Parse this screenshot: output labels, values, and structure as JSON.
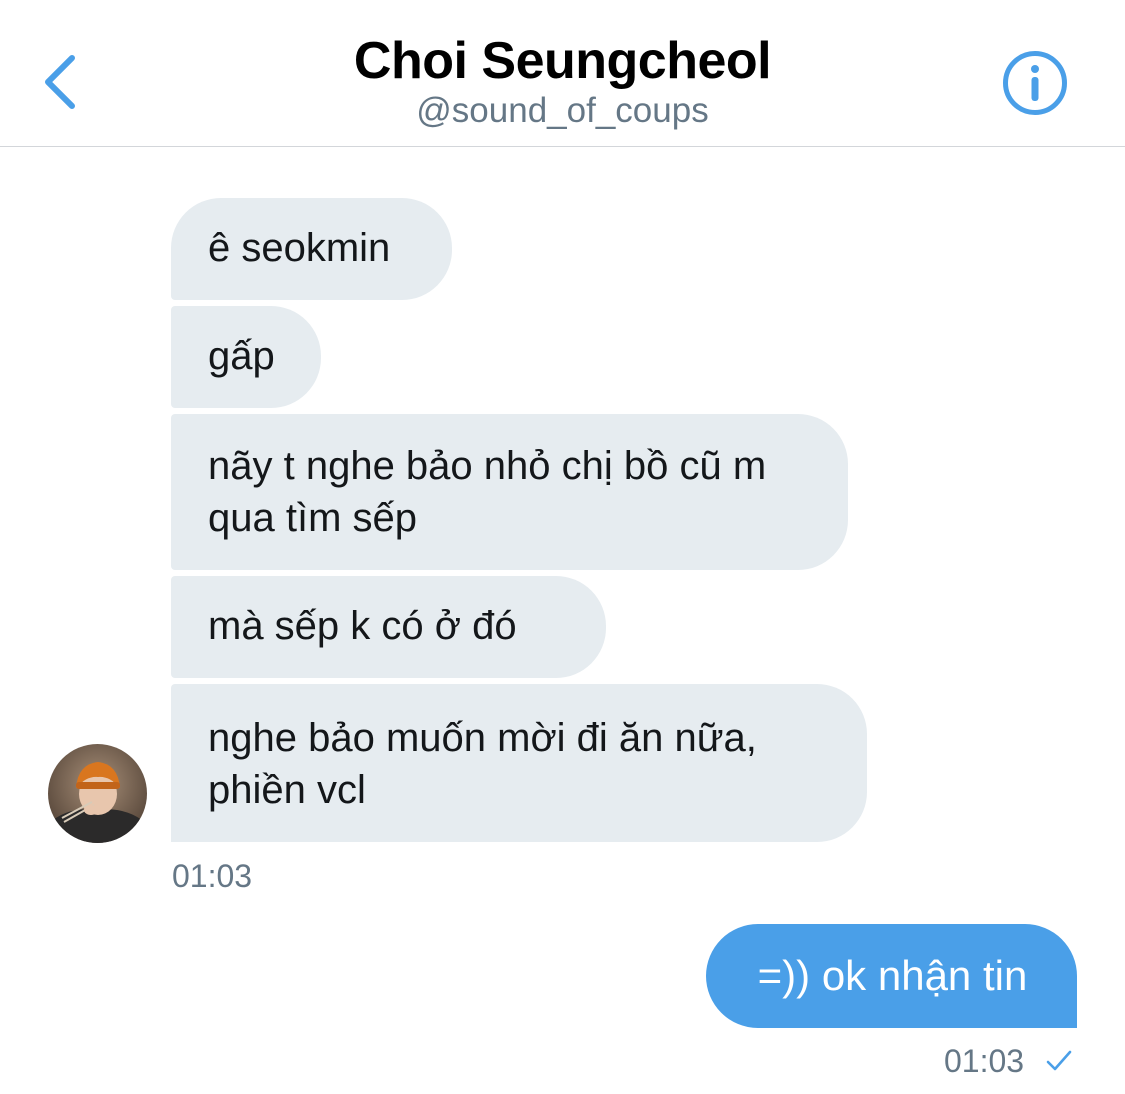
{
  "header": {
    "title": "Choi Seungcheol",
    "handle": "@sound_of_coups",
    "back_icon": "chevron-left-icon",
    "info_icon": "info-icon",
    "accent_color": "#4a9fe8"
  },
  "messages": {
    "incoming": [
      {
        "text": "ê seokmin"
      },
      {
        "text": "gấp"
      },
      {
        "text": "nãy t nghe bảo nhỏ chị bồ cũ m qua tìm sếp"
      },
      {
        "text": "mà sếp k có ở đó"
      },
      {
        "text": "nghe bảo muốn mời đi ăn nữa, phiền vcl"
      }
    ],
    "incoming_time": "01:03",
    "outgoing": [
      {
        "text": "=)) ok nhận tin"
      }
    ],
    "outgoing_time": "01:03",
    "outgoing_status_icon": "checkmark-icon"
  },
  "colors": {
    "incoming_bubble": "#e6ecf0",
    "outgoing_bubble": "#4a9fe8",
    "timestamp": "#657786"
  }
}
